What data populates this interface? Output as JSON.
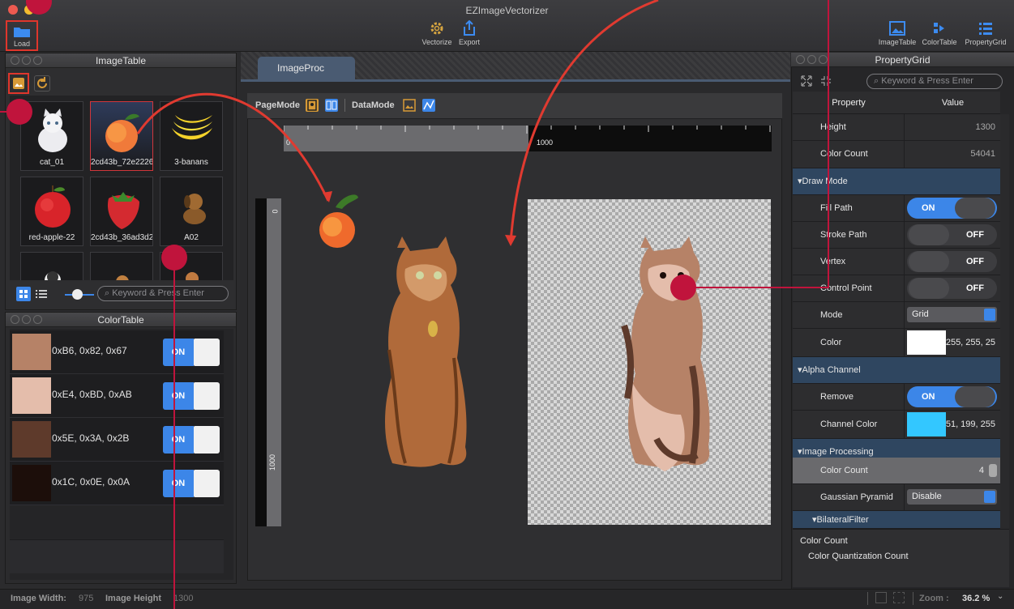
{
  "app": {
    "title": "EZImageVectorizer"
  },
  "toolbar": {
    "load": "Load",
    "vectorize": "Vectorize",
    "export": "Export",
    "imagetable": "ImageTable",
    "colortable": "ColorTable",
    "propertygrid": "PropertyGrid"
  },
  "imagetable": {
    "title": "ImageTable",
    "search_placeholder": "Keyword & Press Enter",
    "items": [
      {
        "label": "cat_01"
      },
      {
        "label": "2cd43b_72e2226..."
      },
      {
        "label": "3-banans"
      },
      {
        "label": "red-apple-22"
      },
      {
        "label": "2cd43b_36ad3d2..."
      },
      {
        "label": "A02"
      }
    ]
  },
  "colortable": {
    "title": "ColorTable",
    "rows": [
      {
        "label": "0xB6, 0x82, 0x67",
        "color": "#B68267",
        "state": "ON"
      },
      {
        "label": "0xE4, 0xBD, 0xAB",
        "color": "#E4BDAB",
        "state": "ON"
      },
      {
        "label": "0x5E, 0x3A, 0x2B",
        "color": "#5E3A2B",
        "state": "ON"
      },
      {
        "label": "0x1C, 0x0E, 0x0A",
        "color": "#1C0E0A",
        "state": "ON"
      }
    ]
  },
  "center": {
    "tab": "ImageProc",
    "pagemode": "PageMode",
    "datamode": "DataMode",
    "ruler_h": [
      "0",
      "1000"
    ],
    "ruler_v": [
      "0",
      "1000"
    ]
  },
  "propertygrid": {
    "title": "PropertyGrid",
    "search_placeholder": "Keyword & Press Enter",
    "col_property": "Property",
    "col_value": "Value",
    "rows": [
      {
        "key": "Height",
        "value": "1300"
      },
      {
        "key": "Color Count",
        "value": "54041"
      },
      {
        "key": "Draw Mode"
      },
      {
        "key": "Fill Path",
        "value": "ON"
      },
      {
        "key": "Stroke Path",
        "value": "OFF"
      },
      {
        "key": "Vertex",
        "value": "OFF"
      },
      {
        "key": "Control Point",
        "value": "OFF"
      },
      {
        "key": "Mode",
        "value": "Grid"
      },
      {
        "key": "Color",
        "value": "255, 255, 25"
      },
      {
        "key": "Alpha Channel"
      },
      {
        "key": "Remove",
        "value": "ON"
      },
      {
        "key": "Channel Color",
        "value": "51, 199, 255"
      },
      {
        "key": "Image Processing"
      },
      {
        "key": "Color Count",
        "value": "4"
      },
      {
        "key": "Gaussian Pyramid",
        "value": "Disable"
      },
      {
        "key": "BilateralFilter"
      }
    ],
    "desc_title": "Color Count",
    "desc_text": "Color Quantization Count"
  },
  "status": {
    "width_label": "Image Width:",
    "width_value": "975",
    "height_label": "Image Height",
    "height_value": "1300",
    "zoom_label": "Zoom :",
    "zoom_value": "36.2 %"
  }
}
